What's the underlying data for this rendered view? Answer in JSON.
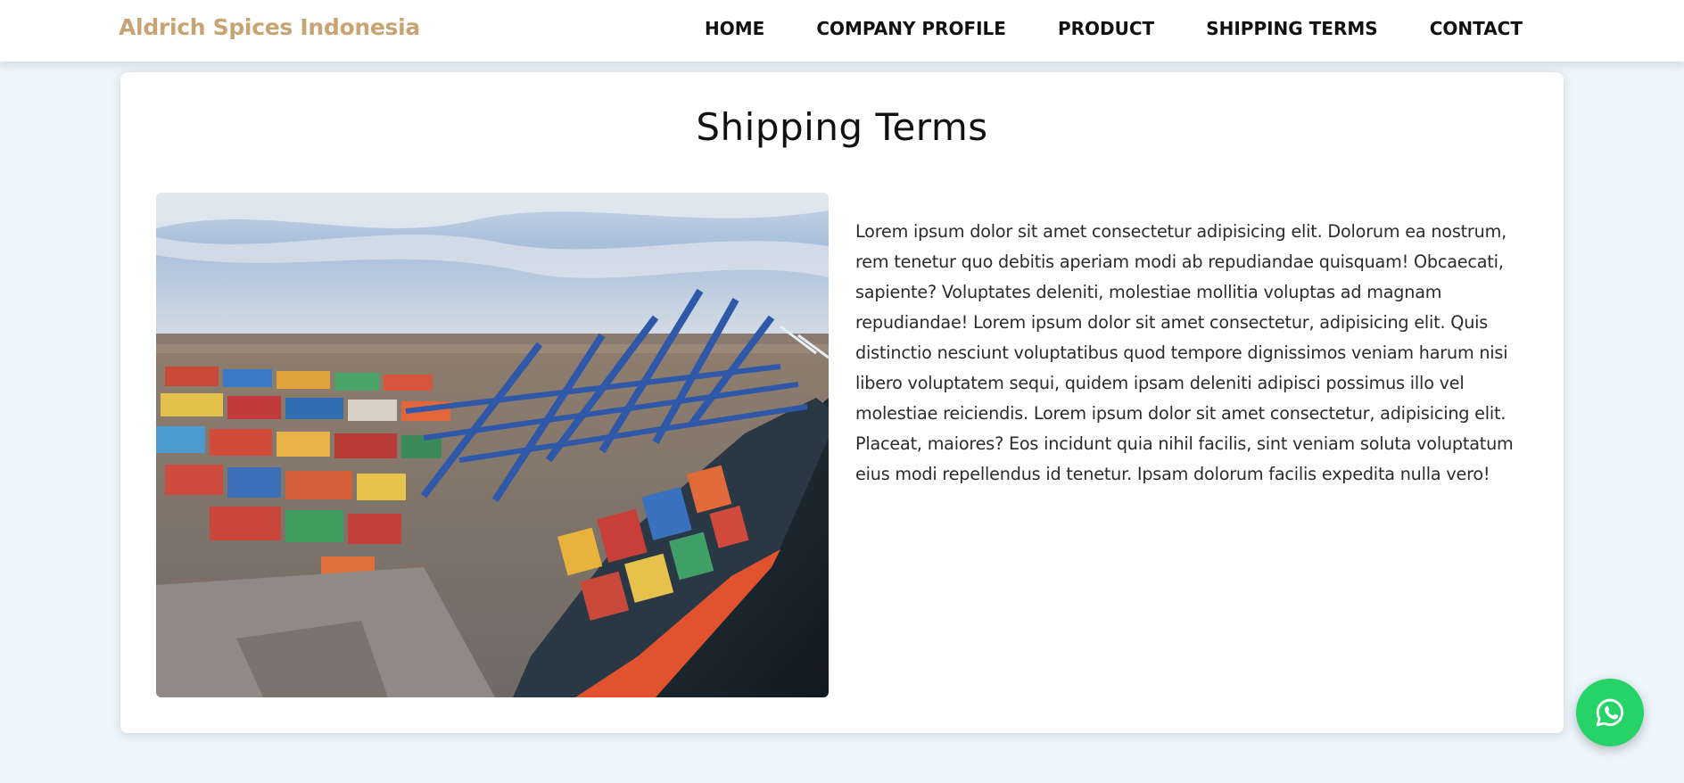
{
  "header": {
    "brand": "Aldrich Spices Indonesia",
    "brand_color": "#c8a472",
    "nav": [
      {
        "label": "HOME"
      },
      {
        "label": "COMPANY PROFILE"
      },
      {
        "label": "PRODUCT"
      },
      {
        "label": "SHIPPING TERMS"
      },
      {
        "label": "CONTACT"
      }
    ]
  },
  "main": {
    "title": "Shipping Terms",
    "image": {
      "icon": "container-port-photo",
      "alt": "Aerial view of a container port with a cargo ship"
    },
    "body": "Lorem ipsum dolor sit amet consectetur adipisicing elit. Dolorum ea nostrum, rem tenetur quo debitis aperiam modi ab repudiandae quisquam! Obcaecati, sapiente? Voluptates deleniti, molestiae mollitia voluptas ad magnam repudiandae! Lorem ipsum dolor sit amet consectetur, adipisicing elit. Quis distinctio nesciunt voluptatibus quod tempore dignissimos veniam harum nisi libero voluptatem sequi, quidem ipsam deleniti adipisci possimus illo vel molestiae reiciendis. Lorem ipsum dolor sit amet consectetur, adipisicing elit. Placeat, maiores? Eos incidunt quia nihil facilis, sint veniam soluta voluptatum eius modi repellendus id tenetur. Ipsam dolorum facilis expedita nulla vero!"
  },
  "floating": {
    "whatsapp_icon": "whatsapp-icon",
    "whatsapp_color": "#25d366"
  },
  "colors": {
    "page_background": "#eef6fd",
    "card_background": "#ffffff"
  }
}
